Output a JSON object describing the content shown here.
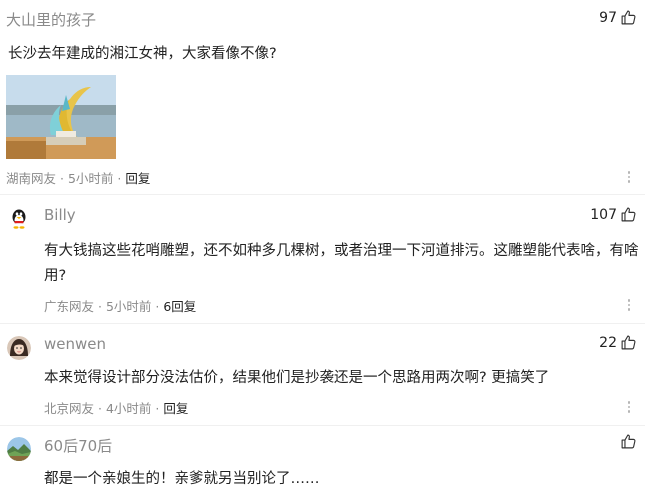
{
  "comments": [
    {
      "name": "大山里的孩子",
      "likes": "97",
      "text": "长沙去年建成的湘江女神，大家看像不像?",
      "region": "湖南网友",
      "time": "5小时前",
      "reply": "回复",
      "image_icon": "statue-photo"
    },
    {
      "name": "Billy",
      "likes": "107",
      "text": "有大钱搞这些花哨雕塑，还不如种多几棵树，或者治理一下河道排污。这雕塑能代表啥，有啥用?",
      "region": "广东网友",
      "time": "5小时前",
      "reply": "6回复",
      "avatar_icon": "penguin-avatar"
    },
    {
      "name": "wenwen",
      "likes": "22",
      "text": "本来觉得设计部分没法估价，结果他们是抄袭还是一个思路用两次啊? 更搞笑了",
      "region": "北京网友",
      "time": "4小时前",
      "reply": "回复",
      "avatar_icon": "girl-avatar"
    },
    {
      "name": "60后70后",
      "likes": "",
      "text": "都是一个亲娘生的！亲爹就另当别论了……",
      "avatar_icon": "landscape-avatar"
    }
  ],
  "meta_separator": " · ",
  "icons": {
    "like": "thumbs-up-icon",
    "more": "more-vertical-icon"
  }
}
